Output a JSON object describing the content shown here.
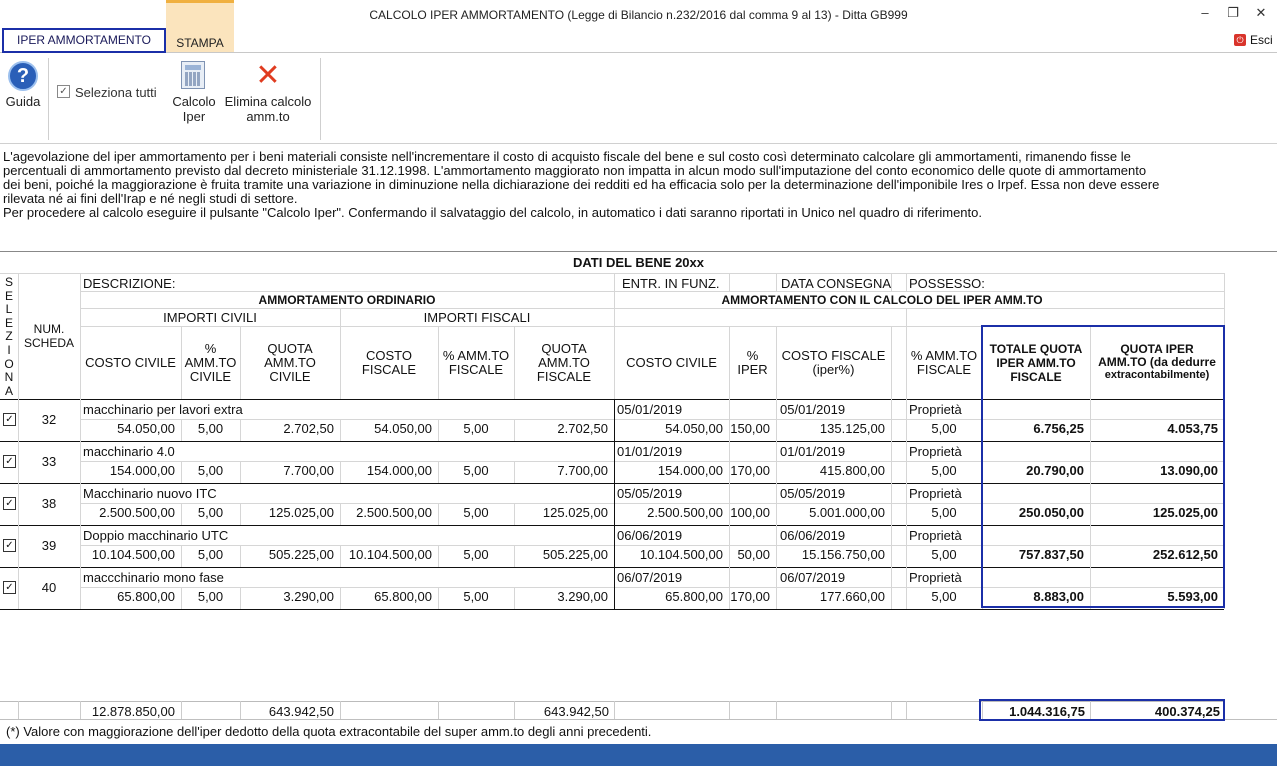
{
  "window": {
    "title": "CALCOLO IPER AMMORTAMENTO (Legge di Bilancio n.232/2016 dal comma 9 al 13) - Ditta GB999",
    "restore_icon": "restore-icon",
    "close_icon": "close-icon"
  },
  "tabs": [
    {
      "label": "IPER AMMORTAMENTO"
    },
    {
      "label": "STAMPA"
    }
  ],
  "exit": {
    "label": "Esci",
    "icon": "exit-icon"
  },
  "ribbon": {
    "guida": "Guida",
    "seleziona": "Seleziona tutti",
    "calcolo_l1": "Calcolo",
    "calcolo_l2": "Iper",
    "elimina_l1": "Elimina calcolo",
    "elimina_l2": "amm.to"
  },
  "description": [
    "L'agevolazione del iper ammortamento per i beni materiali consiste nell'incrementare il costo di acquisto fiscale del bene e sul costo così determinato calcolare gli ammortamenti, rimanendo fisse le",
    "percentuali di ammortamento previsto dal decreto ministeriale 31.12.1998. L'ammortamento maggiorato non impatta in alcun modo sull'imputazione del conto economico delle quote di ammortamento",
    "dei beni, poiché la maggiorazione è fruita tramite una variazione in diminuzione nella dichiarazione dei redditi ed ha efficacia solo per la determinazione dell'imponibile Ires o Irpef. Essa non deve essere",
    "rilevata né ai fini dell'Irap e né negli studi di settore.",
    "Per procedere al calcolo eseguire il pulsante \"Calcolo Iper\". Confermando il salvataggio del calcolo, in automatico i dati saranno riportati in Unico nel quadro di riferimento."
  ],
  "table": {
    "title": "DATI DEL BENE 20xx",
    "h_selez": [
      "S",
      "E",
      "L",
      "E",
      "Z",
      "I",
      "O",
      "N",
      "A"
    ],
    "h_num_l1": "NUM.",
    "h_num_l2": "SCHEDA",
    "h_descrizione": "DESCRIZIONE:",
    "h_entr": "ENTR. IN FUNZ.",
    "h_consegna": "DATA CONSEGNA",
    "h_possesso": "POSSESSO:",
    "h_amm_ord": "AMMORTAMENTO ORDINARIO",
    "h_amm_iper": "AMMORTAMENTO CON IL CALCOLO DEL IPER AMM.TO",
    "h_importi_civili": "IMPORTI CIVILI",
    "h_importi_fiscali": "IMPORTI FISCALI",
    "cols": {
      "costo_civile": [
        "COSTO CIVILE"
      ],
      "perc_civile": [
        "%",
        "AMM.TO",
        "CIVILE"
      ],
      "quota_civile": [
        "QUOTA",
        "AMM.TO",
        "CIVILE"
      ],
      "costo_fiscale": [
        "COSTO",
        "FISCALE"
      ],
      "perc_fiscale": [
        "% AMM.TO",
        "FISCALE"
      ],
      "quota_fiscale": [
        "QUOTA",
        "AMM.TO",
        "FISCALE"
      ],
      "costo_civile2": [
        "COSTO CIVILE"
      ],
      "perc_iper": [
        "%",
        "IPER"
      ],
      "costo_fiscale_iper": [
        "COSTO FISCALE",
        "(iper%)"
      ],
      "perc_fiscale2": [
        "% AMM.TO",
        "FISCALE"
      ],
      "totale_quota": [
        "TOTALE QUOTA",
        "IPER AMM.TO",
        "FISCALE"
      ],
      "quota_iper": [
        "QUOTA IPER",
        "AMM.TO (da dedurre",
        "extracontabilmente)"
      ]
    },
    "rows": [
      {
        "checked": true,
        "num": "32",
        "descr": "macchinario per lavori extra",
        "entr": "05/01/2019",
        "consegna": "05/01/2019",
        "possesso": "Proprietà",
        "v": [
          "54.050,00",
          "5,00",
          "2.702,50",
          "54.050,00",
          "5,00",
          "2.702,50",
          "54.050,00",
          "150,00",
          "135.125,00",
          "5,00",
          "6.756,25",
          "4.053,75"
        ]
      },
      {
        "checked": true,
        "num": "33",
        "descr": "macchinario 4.0",
        "entr": "01/01/2019",
        "consegna": "01/01/2019",
        "possesso": "Proprietà",
        "v": [
          "154.000,00",
          "5,00",
          "7.700,00",
          "154.000,00",
          "5,00",
          "7.700,00",
          "154.000,00",
          "170,00",
          "415.800,00",
          "5,00",
          "20.790,00",
          "13.090,00"
        ]
      },
      {
        "checked": true,
        "num": "38",
        "descr": "Macchinario nuovo ITC",
        "entr": "05/05/2019",
        "consegna": "05/05/2019",
        "possesso": "Proprietà",
        "v": [
          "2.500.500,00",
          "5,00",
          "125.025,00",
          "2.500.500,00",
          "5,00",
          "125.025,00",
          "2.500.500,00",
          "100,00",
          "5.001.000,00",
          "5,00",
          "250.050,00",
          "125.025,00"
        ]
      },
      {
        "checked": true,
        "num": "39",
        "descr": "Doppio macchinario UTC",
        "entr": "06/06/2019",
        "consegna": "06/06/2019",
        "possesso": "Proprietà",
        "v": [
          "10.104.500,00",
          "5,00",
          "505.225,00",
          "10.104.500,00",
          "5,00",
          "505.225,00",
          "10.104.500,00",
          "50,00",
          "15.156.750,00",
          "5,00",
          "757.837,50",
          "252.612,50"
        ]
      },
      {
        "checked": true,
        "num": "40",
        "descr": "maccchinario mono fase",
        "entr": "06/07/2019",
        "consegna": "06/07/2019",
        "possesso": "Proprietà",
        "v": [
          "65.800,00",
          "5,00",
          "3.290,00",
          "65.800,00",
          "5,00",
          "3.290,00",
          "65.800,00",
          "170,00",
          "177.660,00",
          "5,00",
          "8.883,00",
          "5.593,00"
        ]
      }
    ],
    "totals": {
      "costo_civile": "12.878.850,00",
      "quota_civile": "643.942,50",
      "quota_fiscale": "643.942,50",
      "totale_quota": "1.044.316,75",
      "quota_iper": "400.374,25"
    }
  },
  "footnote": "(*) Valore con maggiorazione dell'iper dedotto della quota extracontabile del super amm.to degli anni precedenti.",
  "colors": {
    "accent_blue": "#1b2fa8",
    "status_bar": "#2b5ea8",
    "tab_active": "#fbe4bd"
  }
}
